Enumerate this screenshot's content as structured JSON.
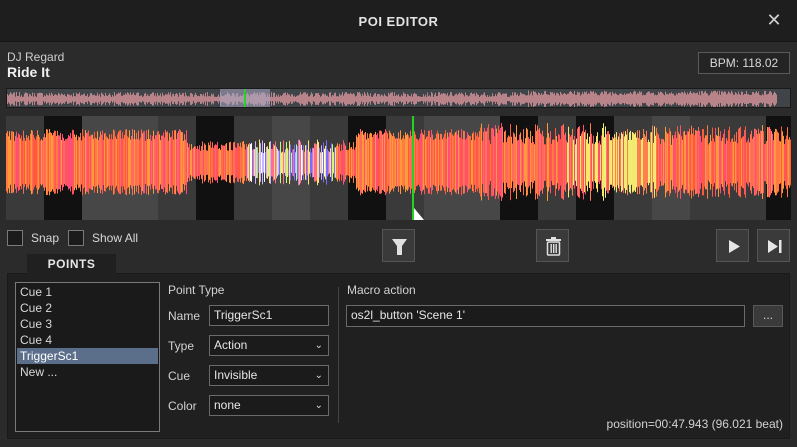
{
  "window": {
    "title": "POI EDITOR",
    "close_icon": "close-icon"
  },
  "track": {
    "artist": "DJ Regard",
    "title": "Ride It",
    "bpm_label": "BPM: 118.02"
  },
  "colors": {
    "playhead": "#22d322",
    "selection": "#a9a9c6",
    "list_selected": "#5c6f8a"
  },
  "controls": {
    "snap_label": "Snap",
    "show_all_label": "Show All",
    "filter_icon": "filter-icon",
    "delete_icon": "trash-icon",
    "play_icon": "play-icon",
    "next_icon": "skip-to-end-icon"
  },
  "points_tab": {
    "label": "POINTS"
  },
  "points_list": {
    "items": [
      "Cue 1",
      "Cue 2",
      "Cue 3",
      "Cue 4",
      "TriggerSc1",
      "New ..."
    ],
    "selected": "TriggerSc1"
  },
  "point_type": {
    "heading": "Point Type",
    "name_label": "Name",
    "name_value": "TriggerSc1",
    "type_label": "Type",
    "type_value": "Action",
    "cue_label": "Cue",
    "cue_value": "Invisible",
    "color_label": "Color",
    "color_value": "none"
  },
  "macro": {
    "heading": "Macro action",
    "value": "os2l_button 'Scene 1'",
    "browse_label": "..."
  },
  "status": {
    "position": "position=00:47.943 (96.021 beat)"
  }
}
